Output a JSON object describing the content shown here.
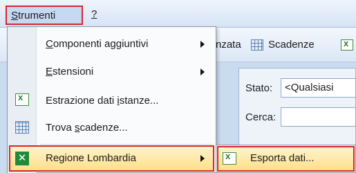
{
  "menubar": {
    "strumenti": {
      "mnemonic": "S",
      "rest": "trumenti"
    },
    "help": {
      "mnemonic": "?",
      "rest": ""
    }
  },
  "toolbar": {
    "partial_label": "nzata",
    "scadenze_label": "Scadenze"
  },
  "panel": {
    "stato_label": "Stato:",
    "stato_value": "<Qualsiasi",
    "cerca_label": "Cerca:",
    "cerca_value": ""
  },
  "menu": {
    "items": [
      {
        "pre": "",
        "mnemonic": "C",
        "post": "omponenti aggiuntivi",
        "submenu": true
      },
      {
        "pre": "",
        "mnemonic": "E",
        "post": "stensioni",
        "submenu": true
      },
      {
        "pre": "Estrazione dati ",
        "mnemonic": "i",
        "post": "stanze...",
        "submenu": false
      },
      {
        "pre": "Trova ",
        "mnemonic": "s",
        "post": "cadenze...",
        "submenu": false
      },
      {
        "pre": "",
        "mnemonic": "",
        "post": "Regione Lombardia",
        "submenu": true
      }
    ]
  },
  "submenu": {
    "items": [
      {
        "label": "Esporta dati..."
      }
    ]
  },
  "colors": {
    "highlight_border": "#d9232a",
    "hover_fill": "#ffe08a",
    "menubar_bg": "#d6e4f5"
  }
}
